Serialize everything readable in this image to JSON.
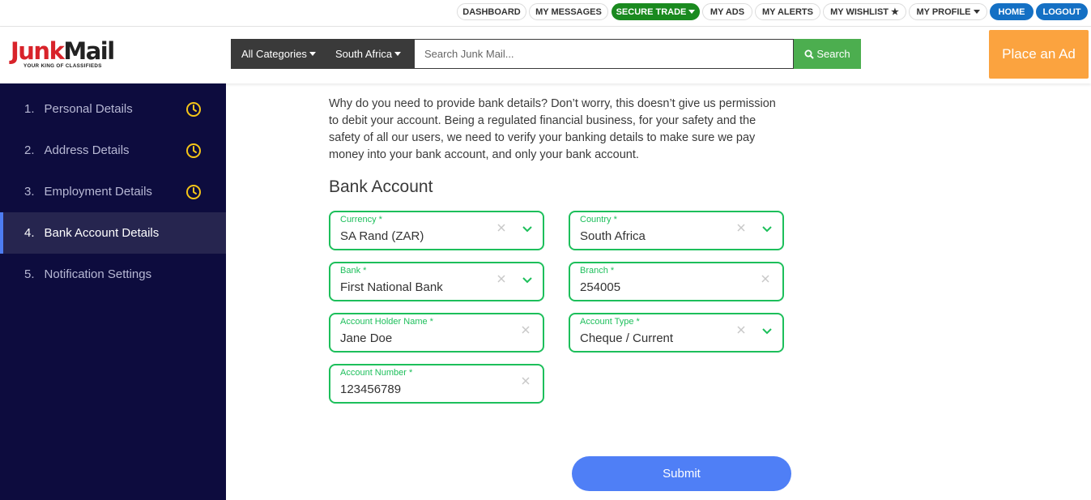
{
  "topnav": {
    "dashboard": "DASHBOARD",
    "my_messages": "MY MESSAGES",
    "secure_trade": "SECURE TRADE",
    "my_ads": "MY ADS",
    "my_alerts": "MY ALERTS",
    "my_wishlist": "MY WISHLIST",
    "my_profile": "MY PROFILE",
    "home": "HOME",
    "logout": "LOGOUT"
  },
  "logo": {
    "word_junk": "Junk",
    "word_mail": "Mail",
    "tagline": "YOUR KING OF CLASSIFIEDS"
  },
  "search": {
    "category": "All Categories",
    "region": "South Africa",
    "placeholder": "Search Junk Mail...",
    "button": "Search"
  },
  "place_ad": "Place an Ad",
  "sidebar": {
    "items": [
      {
        "num": "1.",
        "label": "Personal Details",
        "status": "pending"
      },
      {
        "num": "2.",
        "label": "Address Details",
        "status": "pending"
      },
      {
        "num": "3.",
        "label": "Employment Details",
        "status": "pending"
      },
      {
        "num": "4.",
        "label": "Bank Account Details",
        "status": "active"
      },
      {
        "num": "5.",
        "label": "Notification Settings",
        "status": "none"
      }
    ]
  },
  "main": {
    "intro": "Why do you need to provide bank details? Don’t worry, this doesn’t give us permission to debit your account. Being a regulated financial business, for your safety and the safety of all our users, we need to verify your banking details to make sure we pay money into your bank account, and only your bank account.",
    "section_title": "Bank Account",
    "fields": {
      "currency": {
        "label": "Currency *",
        "value": "SA Rand (ZAR)"
      },
      "country": {
        "label": "Country *",
        "value": "South Africa"
      },
      "bank": {
        "label": "Bank *",
        "value": "First National Bank"
      },
      "branch": {
        "label": "Branch *",
        "value": "254005"
      },
      "account_holder": {
        "label": "Account Holder Name *",
        "value": "Jane Doe"
      },
      "account_type": {
        "label": "Account Type *",
        "value": "Cheque / Current"
      },
      "account_number": {
        "label": "Account Number *",
        "value": "123456789"
      }
    },
    "submit": "Submit"
  },
  "colors": {
    "sidebar_bg": "#0d0c3e",
    "accent_green": "#1dbf5b",
    "submit_blue": "#4f7ff6",
    "place_ad_orange": "#fba33f",
    "clock_yellow": "#f5c518"
  }
}
